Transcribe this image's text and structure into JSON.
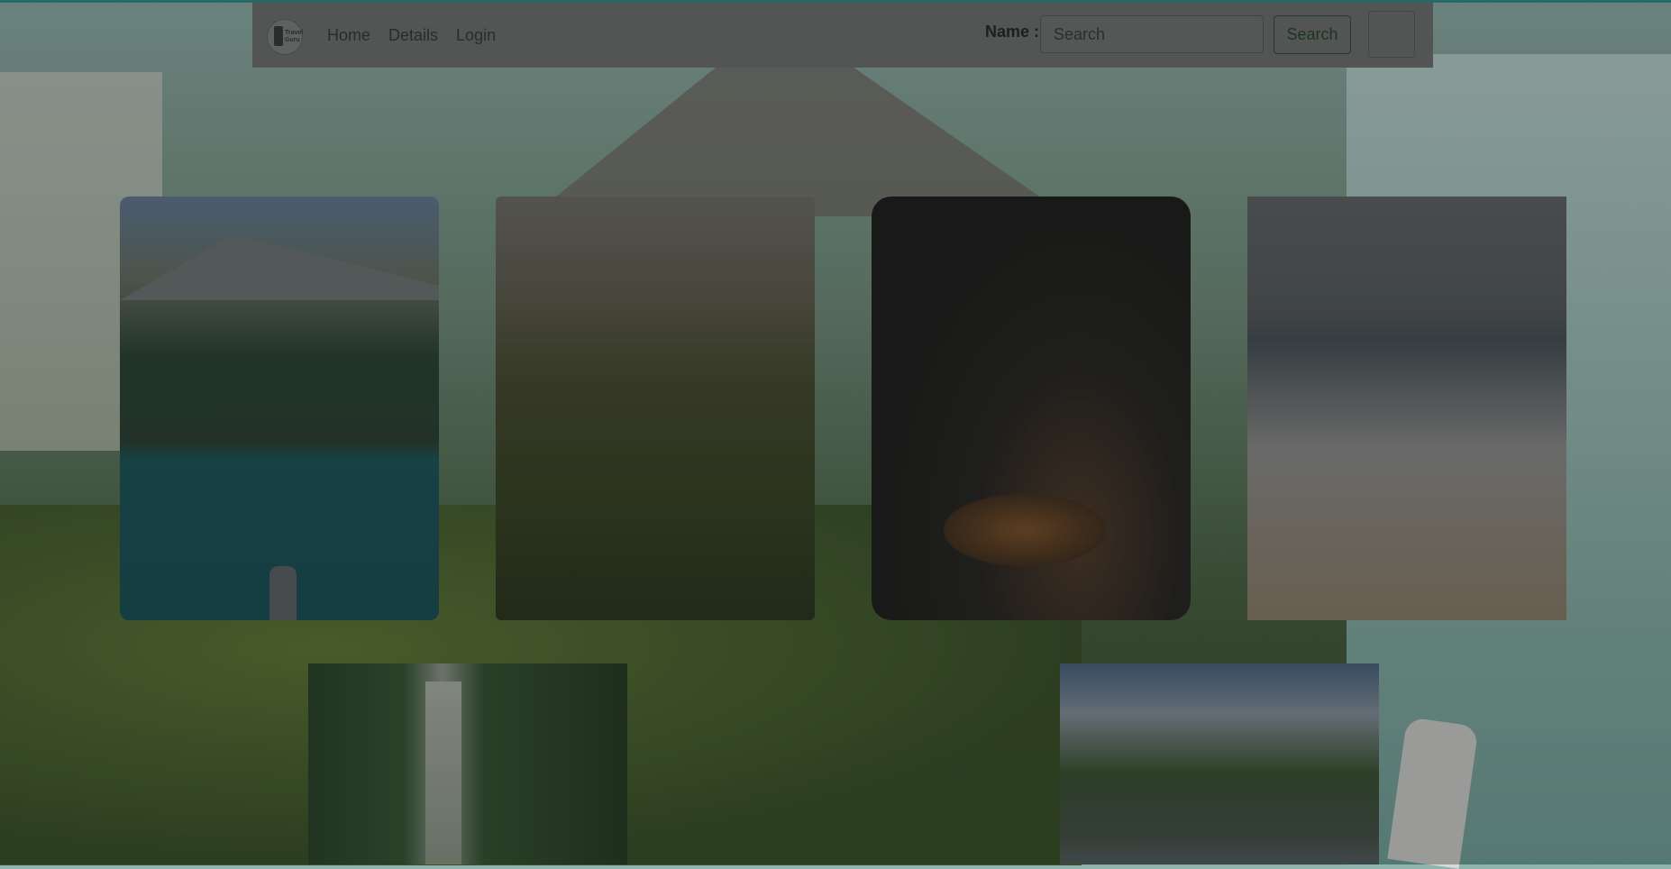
{
  "navbar": {
    "logo_alt": "Travel Guru",
    "links": [
      "Home",
      "Details",
      "Login"
    ],
    "name_label": "Name :",
    "search_placeholder": "Search",
    "search_button": "Search"
  },
  "gallery": {
    "cards": [
      {
        "subject": "mountain-lake"
      },
      {
        "subject": "green-hills"
      },
      {
        "subject": "tiger"
      },
      {
        "subject": "beach"
      },
      {
        "subject": "waterfall"
      },
      {
        "subject": "river-forest"
      }
    ]
  },
  "colors": {
    "accent_line": "#2a8c86",
    "navbar_bg": "#6a6e6d",
    "search_button_border": "#1d4a2a"
  }
}
